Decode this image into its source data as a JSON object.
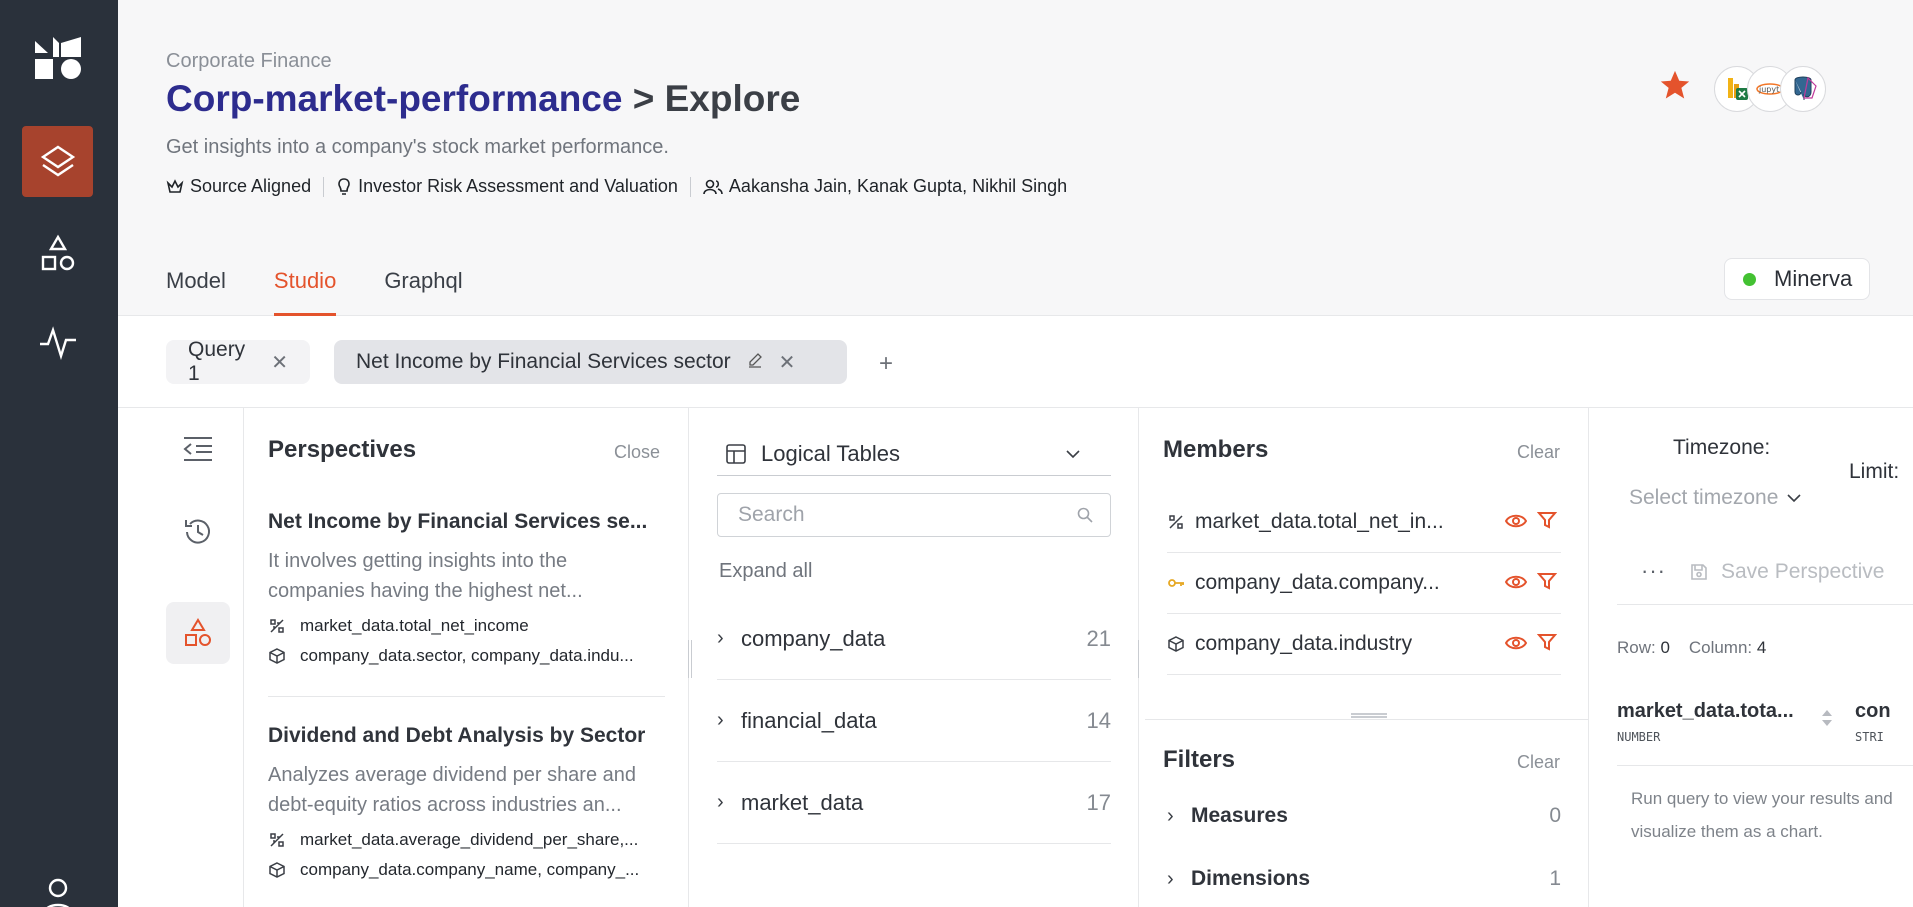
{
  "header": {
    "breadcrumb": "Corporate Finance",
    "product_name": "Corp-market-performance",
    "separator": ">",
    "section": "Explore",
    "description": "Get insights into a company's stock market performance.",
    "meta": {
      "alignment": "Source Aligned",
      "use_case": "Investor Risk Assessment and Valuation",
      "owners": "Aakansha Jain, Kanak Gupta, Nikhil Singh"
    },
    "tabs": [
      {
        "label": "Model"
      },
      {
        "label": "Studio"
      },
      {
        "label": "Graphql"
      }
    ],
    "active_tab": "Studio",
    "cluster": "Minerva",
    "cluster_status_color": "#43c132",
    "accent_color": "#e4532c",
    "brand_color": "#2d2c8e",
    "tools": [
      "excel-icon",
      "jupyter-icon",
      "postgres-icon"
    ]
  },
  "query_tabs": [
    {
      "label": "Query 1"
    },
    {
      "label": "Net Income by Financial Services sector"
    }
  ],
  "perspectives": {
    "title": "Perspectives",
    "close_label": "Close",
    "items": [
      {
        "title": "Net Income by Financial Services se...",
        "description": "It involves getting insights into the companies having the highest net...",
        "measures": "market_data.total_net_income",
        "dimensions": "company_data.sector, company_data.indu..."
      },
      {
        "title": "Dividend and Debt Analysis by Sector",
        "description": "Analyzes average dividend per share and debt-equity ratios across industries an...",
        "measures": "market_data.average_dividend_per_share,...",
        "dimensions": "company_data.company_name, company_..."
      }
    ]
  },
  "logical_tables": {
    "selector_label": "Logical Tables",
    "search_placeholder": "Search",
    "expand_all": "Expand all",
    "tables": [
      {
        "name": "company_data",
        "count": "21"
      },
      {
        "name": "financial_data",
        "count": "14"
      },
      {
        "name": "market_data",
        "count": "17"
      }
    ]
  },
  "members": {
    "title": "Members",
    "clear_label": "Clear",
    "items": [
      {
        "label": "market_data.total_net_in...",
        "icon": "measure-icon"
      },
      {
        "label": "company_data.company...",
        "icon": "key-icon"
      },
      {
        "label": "company_data.industry",
        "icon": "dimension-icon"
      }
    ]
  },
  "filters": {
    "title": "Filters",
    "clear_label": "Clear",
    "groups": [
      {
        "label": "Measures",
        "count": "0"
      },
      {
        "label": "Dimensions",
        "count": "1"
      }
    ]
  },
  "results": {
    "timezone_label": "Timezone:",
    "timezone_placeholder": "Select timezone",
    "limit_label": "Limit:",
    "more_label": "···",
    "save_label": "Save Perspective",
    "row_label": "Row:",
    "row_value": "0",
    "column_label": "Column:",
    "column_value": "4",
    "columns": [
      {
        "name": "market_data.tota...",
        "type": "NUMBER"
      },
      {
        "name": "con",
        "type": "STRI"
      }
    ],
    "hint": "Run query to view your results and visualize them as a chart."
  }
}
